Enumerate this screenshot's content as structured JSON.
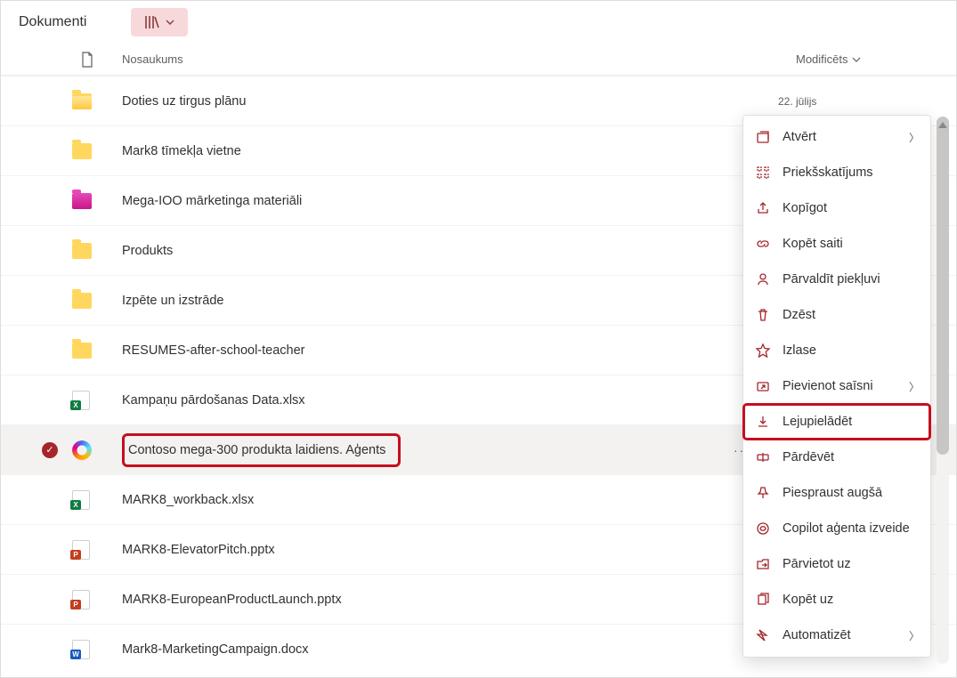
{
  "title": "Dokumenti",
  "columns": {
    "name": "Nosaukums",
    "modified": "Modificēts"
  },
  "rows": [
    {
      "name": "Doties uz tirgus plānu",
      "icon": "folder-yellow-open",
      "modified": "22. jūlijs"
    },
    {
      "name": "Mark8 tīmekļa vietne",
      "icon": "folder-yellow"
    },
    {
      "name": "Mega-IOO mārketinga materiāli",
      "icon": "folder-magenta"
    },
    {
      "name": "Produkts",
      "icon": "folder-yellow"
    },
    {
      "name": "Izpēte un izstrāde",
      "icon": "folder-yellow"
    },
    {
      "name": "RESUMES-after-school-teacher",
      "icon": "folder-yellow"
    },
    {
      "name": "Kampaņu pārdošanas Data.xlsx",
      "icon": "excel"
    },
    {
      "name": "Contoso mega-300 produkta laidiens. Aģents",
      "icon": "copilot",
      "selected": true,
      "showMore": true,
      "highlight": true
    },
    {
      "name": "MARK8_workback.xlsx",
      "icon": "excel"
    },
    {
      "name": "MARK8-ElevatorPitch.pptx",
      "icon": "ppt"
    },
    {
      "name": "MARK8-EuropeanProductLaunch.pptx",
      "icon": "ppt"
    },
    {
      "name": "Mark8-MarketingCampaign.docx",
      "icon": "word"
    }
  ],
  "contextMenu": [
    {
      "label": "Atvērt",
      "icon": "open",
      "chevron": true
    },
    {
      "label": "Priekšskatījums",
      "icon": "preview"
    },
    {
      "label": "Kopīgot",
      "icon": "share"
    },
    {
      "label": "Kopēt saiti",
      "icon": "link"
    },
    {
      "label": "Pārvaldīt piekļuvi",
      "icon": "access"
    },
    {
      "label": "Dzēst",
      "icon": "trash"
    },
    {
      "label": "Izlase",
      "icon": "star"
    },
    {
      "label": "Pievienot saīsni",
      "icon": "shortcut",
      "chevron": true
    },
    {
      "label": "Lejupielādēt",
      "icon": "download",
      "boxed": true
    },
    {
      "label": "Pārdēvēt",
      "icon": "rename"
    },
    {
      "label": "Piespraust augšā",
      "icon": "pin"
    },
    {
      "label": "Copilot aģenta izveide",
      "icon": "copilot-sm"
    },
    {
      "label": "Pārvietot uz",
      "icon": "move"
    },
    {
      "label": "Kopēt uz",
      "icon": "copy"
    },
    {
      "label": "Automatizēt",
      "icon": "automate",
      "chevron": true
    }
  ]
}
